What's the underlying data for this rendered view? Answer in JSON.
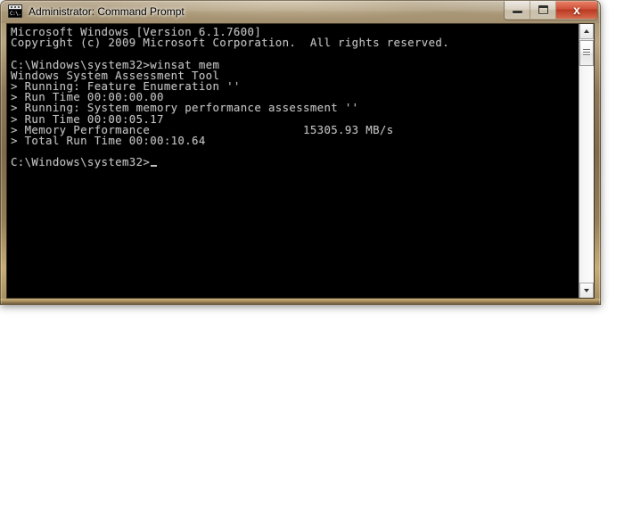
{
  "window": {
    "title": "Administrator: Command Prompt",
    "icon_name": "command-prompt-icon",
    "icon_text": "C:\\.",
    "buttons": {
      "minimize_label": "–",
      "maximize_label": "□",
      "close_label": "x"
    },
    "colors": {
      "frame": "#9b8460",
      "close_button": "#c0452b",
      "console_bg": "#000000",
      "console_fg": "#c0c0c0"
    }
  },
  "console": {
    "lines": [
      "Microsoft Windows [Version 6.1.7600]",
      "Copyright (c) 2009 Microsoft Corporation.  All rights reserved.",
      "",
      "C:\\Windows\\system32>winsat mem",
      "Windows System Assessment Tool",
      "> Running: Feature Enumeration ''",
      "> Run Time 00:00:00.00",
      "> Running: System memory performance assessment ''",
      "> Run Time 00:00:05.17",
      "> Memory Performance                      15305.93 MB/s",
      "> Total Run Time 00:00:10.64",
      "",
      "C:\\Windows\\system32>"
    ],
    "command": "winsat mem",
    "prompt": "C:\\Windows\\system32>",
    "tool_name": "Windows System Assessment Tool",
    "os_version": "Microsoft Windows [Version 6.1.7600]",
    "copyright": "Copyright (c) 2009 Microsoft Corporation.  All rights reserved.",
    "results": {
      "feature_enumeration_run_time": "00:00:00.00",
      "memory_assessment_run_time": "00:00:05.17",
      "memory_performance_value": "15305.93",
      "memory_performance_unit": "MB/s",
      "total_run_time": "00:00:10.64"
    },
    "cursor_visible": true
  },
  "scrollbar": {
    "up_arrow": "▲",
    "down_arrow": "▼",
    "thumb_position_percent": 0,
    "orientation": "vertical"
  }
}
